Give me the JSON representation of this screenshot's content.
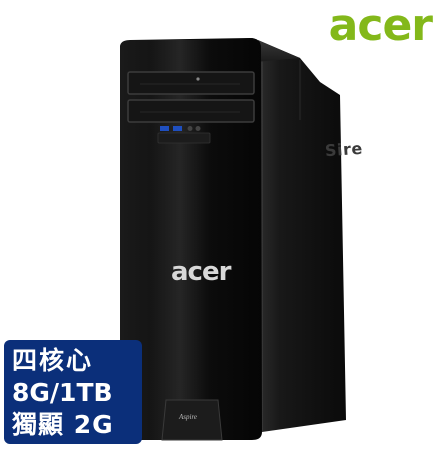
{
  "brand": {
    "logo_text": "acer",
    "logo_color": "#83b81a"
  },
  "product": {
    "front_brand": "acer",
    "model_badge": "Aspire",
    "side_print": "Sire"
  },
  "badge": {
    "lines": [
      "四核心",
      "8G/1TB",
      "獨顯 2G"
    ],
    "background_color": "#0b2f7a",
    "text_color": "#ffffff"
  }
}
